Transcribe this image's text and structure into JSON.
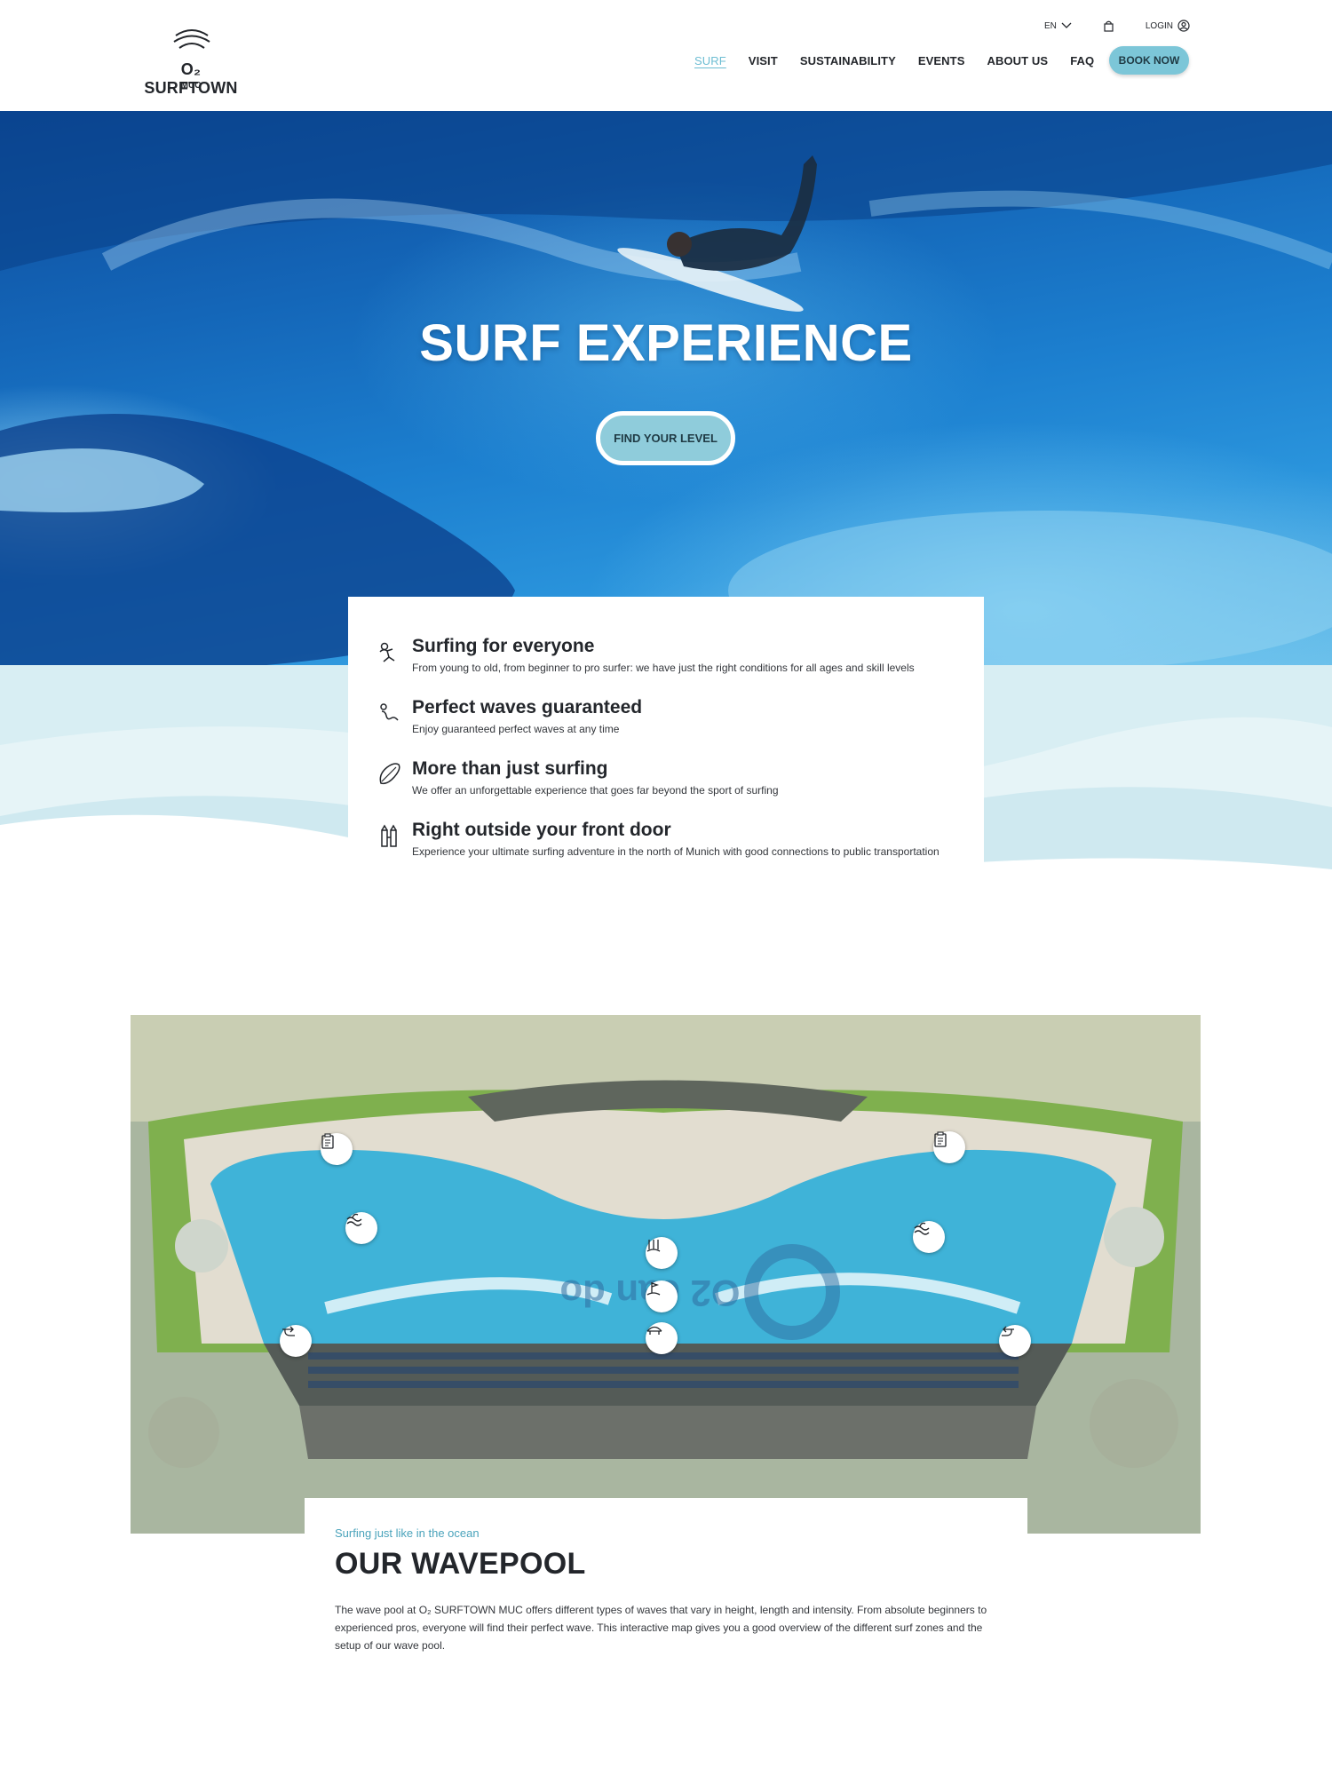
{
  "brand": {
    "name": "O₂ SURFTOWN",
    "sub": "MUC"
  },
  "utility": {
    "language": "EN",
    "login": "LOGIN"
  },
  "nav": [
    {
      "label": "SURF",
      "active": true
    },
    {
      "label": "VISIT"
    },
    {
      "label": "SUSTAINABILITY"
    },
    {
      "label": "EVENTS"
    },
    {
      "label": "ABOUT US"
    },
    {
      "label": "FAQ"
    }
  ],
  "cta": {
    "book_now": "BOOK NOW"
  },
  "hero": {
    "title": "SURF EXPERIENCE",
    "button": "FIND YOUR LEVEL"
  },
  "features": [
    {
      "icon": "surfer-icon",
      "title": "Surfing for everyone",
      "text": "From young to old, from beginner to pro surfer: we have just the right conditions for all ages and skill levels"
    },
    {
      "icon": "wave-surfer-icon",
      "title": "Perfect waves guaranteed",
      "text": "Enjoy guaranteed perfect waves at any time"
    },
    {
      "icon": "surfboard-icon",
      "title": "More than just surfing",
      "text": "We offer an unforgettable experience that goes far beyond the sport of surfing"
    },
    {
      "icon": "city-gate-icon",
      "title": "Right outside your front door",
      "text": "Experience your ultimate surfing adventure in the north of Munich with good connections to public transportation"
    }
  ],
  "map": {
    "pool_lettering": "O2 can do",
    "pins": [
      "clipboard-icon",
      "clipboard-icon",
      "waves-icon",
      "waves-icon",
      "wave-generator-icon",
      "flag-icon",
      "bridge-icon",
      "direction-right-icon",
      "direction-left-icon"
    ]
  },
  "wavepool": {
    "eyebrow": "Surfing just like in the ocean",
    "title": "OUR WAVEPOOL",
    "text": "The wave pool at O₂ SURFTOWN MUC offers different types of waves that vary in height, length and intensity. From absolute beginners to experienced pros, everyone will find their perfect wave. This interactive map gives you a good overview of the different surf zones and the setup of our wave pool."
  },
  "colors": {
    "accent": "#7cc6d8",
    "accent_text": "#4aa3bb",
    "ink": "#23262b",
    "pool": "#3fb3d8"
  }
}
